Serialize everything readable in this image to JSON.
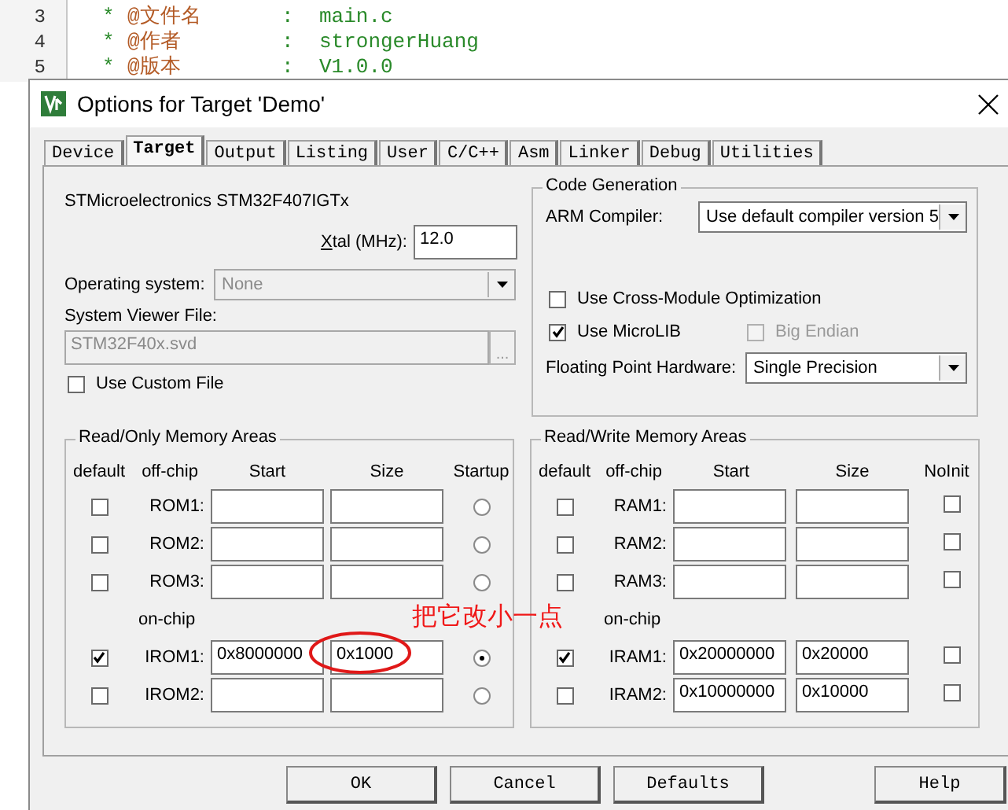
{
  "editor": {
    "lines": [
      {
        "number": "3",
        "marker": "*",
        "tag": "@文件名",
        "separator": ":",
        "value": "main.c"
      },
      {
        "number": "4",
        "marker": "*",
        "tag": "@作者",
        "separator": ":",
        "value": "strongerHuang"
      },
      {
        "number": "5",
        "marker": "*",
        "tag": "@版本",
        "separator": ":",
        "value": "V1.0.0"
      }
    ]
  },
  "window": {
    "title": "Options for Target 'Demo'"
  },
  "tabs": [
    {
      "label": "Device",
      "selected": false
    },
    {
      "label": "Target",
      "selected": true
    },
    {
      "label": "Output",
      "selected": false
    },
    {
      "label": "Listing",
      "selected": false
    },
    {
      "label": "User",
      "selected": false
    },
    {
      "label": "C/C++",
      "selected": false
    },
    {
      "label": "Asm",
      "selected": false
    },
    {
      "label": "Linker",
      "selected": false
    },
    {
      "label": "Debug",
      "selected": false
    },
    {
      "label": "Utilities",
      "selected": false
    }
  ],
  "device": {
    "name": "STMicroelectronics STM32F407IGTx",
    "xtal_label": "Xtal (MHz):",
    "xtal_value": "12.0",
    "os_label": "Operating system:",
    "os_value": "None",
    "svd_label": "System Viewer File:",
    "svd_value": "STM32F40x.svd",
    "browse_label": "...",
    "custom_file": {
      "label": "Use Custom File",
      "checked": false
    }
  },
  "code_generation": {
    "title": "Code Generation",
    "compiler_label": "ARM Compiler:",
    "compiler_value": "Use default compiler version 5",
    "options": [
      {
        "label": "Use Cross-Module Optimization",
        "checked": false,
        "disabled": false
      },
      {
        "label": "Use MicroLIB",
        "checked": true,
        "disabled": false
      },
      {
        "label": "Big Endian",
        "checked": false,
        "disabled": true
      }
    ],
    "fpu_label": "Floating Point Hardware:",
    "fpu_value": "Single Precision"
  },
  "rom": {
    "title": "Read/Only Memory Areas",
    "columns": [
      "default",
      "off-chip",
      "Start",
      "Size",
      "Startup"
    ],
    "rows": [
      {
        "kind": "area",
        "name": "ROM1:",
        "default": false,
        "selected": false
      },
      {
        "kind": "area",
        "name": "ROM2:",
        "default": false,
        "selected": false
      },
      {
        "kind": "area",
        "name": "ROM3:",
        "default": false,
        "selected": false
      },
      {
        "kind": "heading",
        "label": "on-chip"
      },
      {
        "kind": "area",
        "name": "IROM1:",
        "default": true,
        "start": "0x8000000",
        "size": "0x1000",
        "selected": true
      },
      {
        "kind": "area",
        "name": "IROM2:",
        "default": false,
        "selected": false
      }
    ]
  },
  "ram": {
    "title": "Read/Write Memory Areas",
    "columns": [
      "default",
      "off-chip",
      "Start",
      "Size",
      "NoInit"
    ],
    "rows": [
      {
        "kind": "area",
        "name": "RAM1:",
        "default": false,
        "no_init": false
      },
      {
        "kind": "area",
        "name": "RAM2:",
        "default": false,
        "no_init": false
      },
      {
        "kind": "area",
        "name": "RAM3:",
        "default": false,
        "no_init": false
      },
      {
        "kind": "heading",
        "label": "on-chip"
      },
      {
        "kind": "area",
        "name": "IRAM1:",
        "default": true,
        "start": "0x20000000",
        "size": "0x20000",
        "no_init": false
      },
      {
        "kind": "area",
        "name": "IRAM2:",
        "default": false,
        "start": "0x10000000",
        "size": "0x10000",
        "no_init": false
      }
    ]
  },
  "annotation": {
    "text": "把它改小一点"
  },
  "buttons": [
    "OK",
    "Cancel",
    "Defaults",
    "Help"
  ]
}
